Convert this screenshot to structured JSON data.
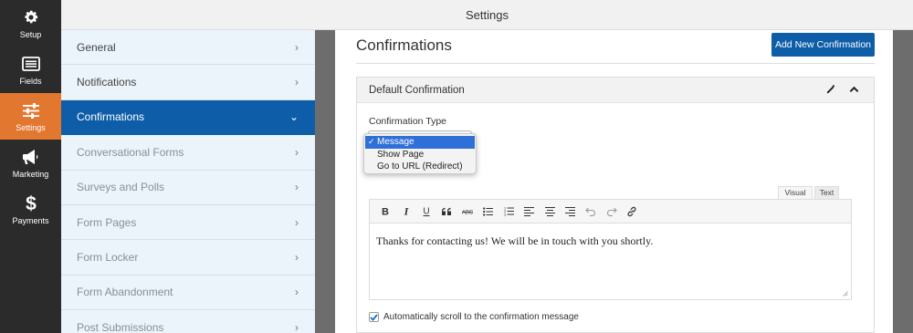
{
  "rail": {
    "items": [
      {
        "label": "Setup",
        "icon": "gear-icon"
      },
      {
        "label": "Fields",
        "icon": "fields-icon"
      },
      {
        "label": "Settings",
        "icon": "sliders-icon"
      },
      {
        "label": "Marketing",
        "icon": "megaphone-icon"
      },
      {
        "label": "Payments",
        "icon": "dollar-icon"
      }
    ],
    "active_color": "#e27730"
  },
  "header": {
    "title": "Settings"
  },
  "panels": {
    "items": [
      {
        "label": "General"
      },
      {
        "label": "Notifications"
      },
      {
        "label": "Confirmations"
      },
      {
        "label": "Conversational Forms"
      },
      {
        "label": "Surveys and Polls"
      },
      {
        "label": "Form Pages"
      },
      {
        "label": "Form Locker"
      },
      {
        "label": "Form Abandonment"
      },
      {
        "label": "Post Submissions"
      }
    ],
    "active": "Confirmations",
    "active_color": "#0e5da8"
  },
  "main": {
    "title": "Confirmations",
    "add_button": "Add New Confirmation",
    "confirmation": {
      "name": "Default Confirmation",
      "type_label": "Confirmation Type",
      "type_options": [
        "Message",
        "Show Page",
        "Go to URL (Redirect)"
      ],
      "selected_type": "Message",
      "check_mark": "✓",
      "editor_tabs": {
        "visual": "Visual",
        "text": "Text"
      },
      "toolbar": [
        "bold-icon",
        "italic-icon",
        "underline-icon",
        "blockquote-icon",
        "strikethrough-icon",
        "bullet-list-icon",
        "numbered-list-icon",
        "align-left-icon",
        "align-center-icon",
        "align-right-icon",
        "undo-icon",
        "redo-icon",
        "link-icon"
      ],
      "message": "Thanks for contacting us! We will be in touch with you shortly.",
      "auto_scroll_label": "Automatically scroll to the confirmation message",
      "auto_scroll_checked": true
    }
  }
}
